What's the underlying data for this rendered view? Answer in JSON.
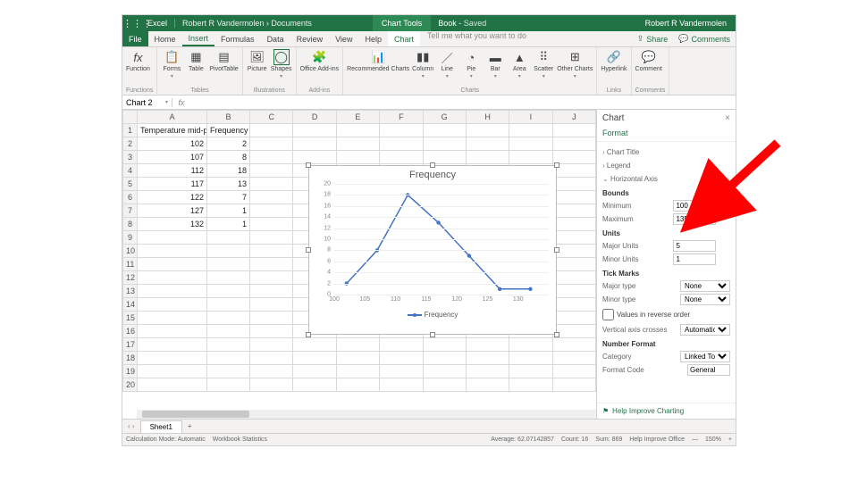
{
  "title": {
    "app": "Excel",
    "path": "Robert R Vandermolen › Documents",
    "tools": "Chart Tools",
    "doc": "Book",
    "saved": "Saved",
    "user": "Robert R Vandermolen"
  },
  "tabs": {
    "file": "File",
    "home": "Home",
    "insert": "Insert",
    "formulas": "Formulas",
    "data": "Data",
    "review": "Review",
    "view": "View",
    "help": "Help",
    "chart": "Chart",
    "tellme": "Tell me what you want to do",
    "share": "Share",
    "comments": "Comments"
  },
  "ribbon": {
    "fx": "fx",
    "fxlabel": "Function",
    "functions": "Functions",
    "forms": "Forms",
    "table": "Table",
    "pivot": "PivotTable",
    "tables": "Tables",
    "picture": "Picture",
    "shapes": "Shapes",
    "addins": "Office Add-ins",
    "illustrations": "Illustrations",
    "addinsgrp": "Add-ins",
    "rec": "Recommended Charts",
    "column": "Column",
    "line": "Line",
    "pie": "Pie",
    "bar": "Bar",
    "area": "Area",
    "scatter": "Scatter",
    "other": "Other Charts",
    "charts": "Charts",
    "hyperlink": "Hyperlink",
    "comment": "Comment",
    "links": "Links",
    "comments": "Comments"
  },
  "namebox": "Chart 2",
  "columns": [
    "A",
    "B",
    "C",
    "D",
    "E",
    "F",
    "G",
    "H",
    "I",
    "J"
  ],
  "headers": {
    "a": "Temperature mid-points",
    "b": "Frequency"
  },
  "rows": [
    {
      "a": "102",
      "b": "2"
    },
    {
      "a": "107",
      "b": "8"
    },
    {
      "a": "112",
      "b": "18"
    },
    {
      "a": "117",
      "b": "13"
    },
    {
      "a": "122",
      "b": "7"
    },
    {
      "a": "127",
      "b": "1"
    },
    {
      "a": "132",
      "b": "1"
    }
  ],
  "chart_data": {
    "type": "line",
    "title": "Frequency",
    "legend": "Frequency",
    "x": [
      102,
      107,
      112,
      117,
      122,
      127,
      132
    ],
    "values": [
      2,
      8,
      18,
      13,
      7,
      1,
      1
    ],
    "xlabel": "",
    "ylabel": "",
    "xlim": [
      100,
      135
    ],
    "ylim": [
      0,
      20
    ],
    "yticks": [
      0,
      2,
      4,
      6,
      8,
      10,
      12,
      14,
      16,
      18,
      20
    ],
    "xticks": [
      100,
      105,
      110,
      115,
      120,
      125,
      130
    ],
    "series_color": "#4472C4"
  },
  "pane": {
    "title": "Chart",
    "format": "Format",
    "chart_title": "Chart Title",
    "legend": "Legend",
    "haxis": "Horizontal Axis",
    "bounds": "Bounds",
    "min": "Minimum",
    "min_v": "100",
    "max": "Maximum",
    "max_v": "135",
    "units": "Units",
    "major": "Major Units",
    "major_v": "5",
    "minor": "Minor Units",
    "minor_v": "1",
    "ticks": "Tick Marks",
    "majort": "Major type",
    "minort": "Minor type",
    "none": "None",
    "reverse": "Values in reverse order",
    "vcross": "Vertical axis crosses",
    "auto": "Automatic",
    "numfmt": "Number Format",
    "category": "Category",
    "linked": "Linked To So...",
    "code": "Format Code",
    "general": "General",
    "help": "Help Improve Charting"
  },
  "sheet": {
    "tab": "Sheet1"
  },
  "status": {
    "mode": "Calculation Mode: Automatic",
    "wb": "Workbook Statistics",
    "avg": "Average: 62.07142857",
    "count": "Count: 16",
    "sum": "Sum: 869",
    "help": "Help Improve Office",
    "zoom": "150%"
  }
}
